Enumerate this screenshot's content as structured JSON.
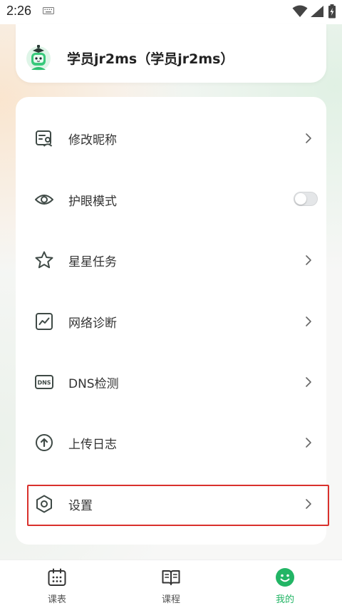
{
  "status_bar": {
    "time": "2:26"
  },
  "profile": {
    "name": "学员jr2ms（学员jr2ms）"
  },
  "menu": {
    "items": [
      {
        "label": "修改昵称",
        "icon": "edit-profile-icon",
        "control": "chevron"
      },
      {
        "label": "护眼模式",
        "icon": "eye-icon",
        "control": "toggle",
        "toggle_on": false
      },
      {
        "label": "星星任务",
        "icon": "star-icon",
        "control": "chevron"
      },
      {
        "label": "网络诊断",
        "icon": "network-chart-icon",
        "control": "chevron"
      },
      {
        "label": "DNS检测",
        "icon": "dns-icon",
        "control": "chevron"
      },
      {
        "label": "上传日志",
        "icon": "upload-icon",
        "control": "chevron"
      },
      {
        "label": "设置",
        "icon": "settings-hexagon-icon",
        "control": "chevron",
        "highlighted": true
      }
    ]
  },
  "bottom_nav": {
    "tabs": [
      {
        "label": "课表",
        "icon": "calendar-icon",
        "active": false
      },
      {
        "label": "课程",
        "icon": "book-icon",
        "active": false
      },
      {
        "label": "我的",
        "icon": "smiley-icon",
        "active": true
      }
    ]
  },
  "colors": {
    "accent": "#22b565",
    "highlight_border": "#d9302c",
    "icon_dark": "#3f4a46"
  }
}
